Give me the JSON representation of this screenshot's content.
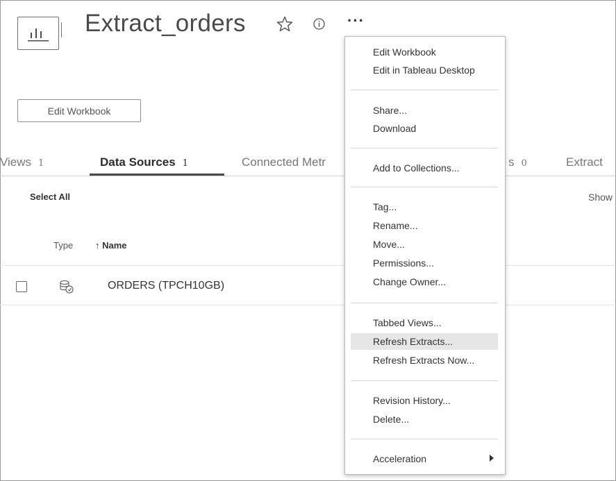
{
  "workbook": {
    "title": "Extract_orders",
    "edit_button": "Edit Workbook"
  },
  "icons": {
    "workbook": "bar-chart-icon",
    "favorite": "star-icon",
    "info": "info-icon",
    "more": "more-actions-icon",
    "datasource": "extract-datasource-icon",
    "submenu": "caret-right-icon"
  },
  "tabs": [
    {
      "label": "Views",
      "count": "1"
    },
    {
      "label": "Data Sources",
      "count": "1",
      "active": true
    },
    {
      "label": "Connected Metr",
      "count": ""
    },
    {
      "label": "s",
      "count": "0"
    },
    {
      "label": "Extract",
      "count": ""
    }
  ],
  "list": {
    "select_all": "Select All",
    "show": "Show",
    "columns": {
      "type": "Type",
      "name": "Name",
      "sort_indicator": "↑"
    },
    "rows": [
      {
        "name": "ORDERS (TPCH10GB)"
      }
    ]
  },
  "menu": {
    "more_glyph": "···",
    "items": [
      "Edit Workbook",
      "Edit in Tableau Desktop",
      "Share...",
      "Download",
      "Add to Collections...",
      "Tag...",
      "Rename...",
      "Move...",
      "Permissions...",
      "Change Owner...",
      "Tabbed Views...",
      "Refresh Extracts...",
      "Refresh Extracts Now...",
      "Revision History...",
      "Delete...",
      "Acceleration"
    ],
    "highlighted": "Refresh Extracts..."
  },
  "colors": {
    "active_tab_underline": "#4a4a4a",
    "menu_highlight": "#e6e6e6"
  }
}
